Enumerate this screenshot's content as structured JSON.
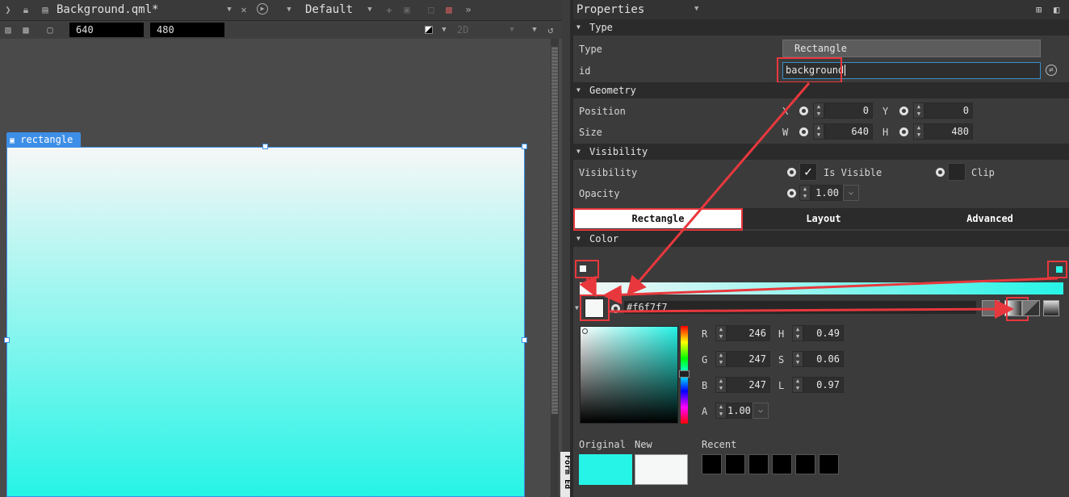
{
  "editor": {
    "file_tab": "Background.qml*",
    "state_combo": "Default",
    "width_value": "640",
    "height_value": "480",
    "view_mode": "2D",
    "item_label": "rectangle",
    "form_editor_tab": "Form Ed"
  },
  "properties": {
    "title": "Properties",
    "type_section": {
      "header": "Type",
      "type_label": "Type",
      "type_value": "Rectangle",
      "id_label": "id",
      "id_value": "background"
    },
    "geometry_section": {
      "header": "Geometry",
      "position_label": "Position",
      "size_label": "Size",
      "x_label": "X",
      "x_value": "0",
      "y_label": "Y",
      "y_value": "0",
      "w_label": "W",
      "w_value": "640",
      "h_label": "H",
      "h_value": "480"
    },
    "visibility_section": {
      "header": "Visibility",
      "visibility_label": "Visibility",
      "is_visible_label": "Is Visible",
      "is_visible_checked": true,
      "clip_label": "Clip",
      "clip_checked": false,
      "opacity_label": "Opacity",
      "opacity_value": "1.00"
    },
    "tabs": [
      "Rectangle",
      "Layout",
      "Advanced"
    ],
    "active_tab": "Rectangle",
    "color_section": {
      "header": "Color",
      "hex_value": "#f6f7f7",
      "gradient_start": "#f6f7f7",
      "gradient_end": "#26f4e6",
      "r_label": "R",
      "r_value": "246",
      "g_label": "G",
      "g_value": "247",
      "b_label": "B",
      "b_value": "247",
      "a_label": "A",
      "a_value": "1.00",
      "h_label": "H",
      "h_value": "0.49",
      "s_label": "S",
      "s_value": "0.06",
      "l_label": "L",
      "l_value": "0.97",
      "original_label": "Original",
      "new_label": "New",
      "recent_label": "Recent",
      "original_color": "#26f4e6",
      "new_color": "#f6f7f7"
    }
  },
  "colors": {
    "accent_blue": "#3d8ee6",
    "highlight_red": "#e8383d",
    "canvas_bg": "#4a4a4b"
  }
}
